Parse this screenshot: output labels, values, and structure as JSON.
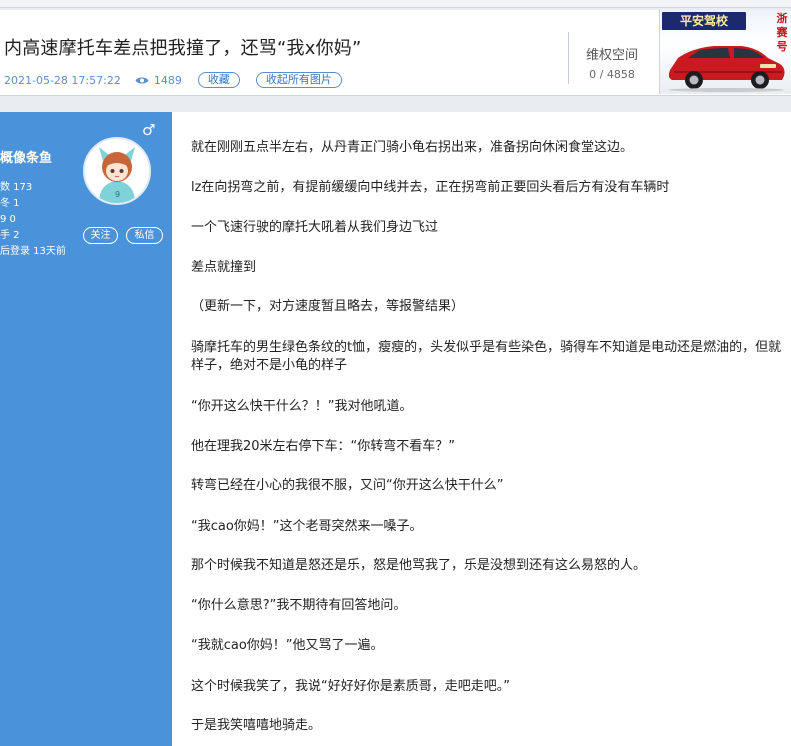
{
  "post": {
    "title": "内高速摩托车差点把我撞了，还骂“我x你妈”",
    "date": "2021-05-28 17:57:22",
    "views": "1489",
    "collect_label": "收藏",
    "collect_images_label": "收起所有图片"
  },
  "space": {
    "title": "维权空间",
    "count": "0 / 4858"
  },
  "ad": {
    "brand": "平安驾校",
    "side_text": "浙\n赛\n号"
  },
  "user": {
    "name": "概像条鱼",
    "stats": [
      "数 173",
      "冬 1",
      "9 0",
      "手 2",
      "后登录 13天前"
    ],
    "follow_label": "关注",
    "message_label": "私信"
  },
  "content": {
    "paragraphs": [
      "就在刚刚五点半左右，从丹青正门骑小龟右拐出来，准备拐向休闲食堂这边。",
      "lz在向拐弯之前，有提前缓缓向中线并去，正在拐弯前正要回头看后方有没有车辆时",
      "一个飞速行驶的摩托大吼着从我们身边飞过",
      "差点就撞到",
      "（更新一下，对方速度暂且略去，等报警结果）",
      "骑摩托车的男生绿色条纹的t恤，瘦瘦的，头发似乎是有些染色，骑得车不知道是电动还是燃油的，但就",
      "样子，绝对不是小龟的样子",
      "“你开这么快干什么？！”我对他吼道。",
      "他在理我20米左右停下车：“你转弯不看车？”",
      "转弯已经在小心的我很不服，又问“你开这么快干什么”",
      "“我cao你妈！”这个老哥突然来一嗓子。",
      "那个时候我不知道是怒还是乐，怒是他骂我了，乐是没想到还有这么易怒的人。",
      "“你什么意思?”我不期待有回答地问。",
      "“我就cao你妈！”他又骂了一遍。",
      "这个时候我笑了，我说“好好好你是素质哥，走吧走吧。”",
      "于是我笑嘻嘻地骑走。"
    ]
  }
}
